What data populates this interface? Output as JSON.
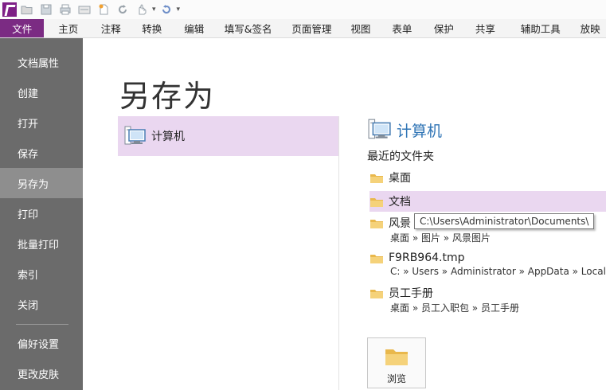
{
  "qat": {
    "icons": [
      "open-folder-icon",
      "save-icon",
      "print-icon",
      "scan-icon",
      "new-document-icon",
      "redo-icon",
      "hand-tool-icon",
      "undo-icon"
    ],
    "dropdown_glyph": "▾"
  },
  "tabs": [
    "文件",
    "主页",
    "注释",
    "转换",
    "编辑",
    "填写&签名",
    "页面管理",
    "视图",
    "表单",
    "保护",
    "共享",
    "辅助工具",
    "放映"
  ],
  "nav": {
    "items": [
      "文档属性",
      "创建",
      "打开",
      "保存",
      "另存为",
      "打印",
      "批量打印",
      "索引",
      "关闭",
      "偏好设置",
      "更改皮肤"
    ],
    "active": "另存为"
  },
  "main": {
    "title": "另存为",
    "place": "计算机",
    "right_title": "计算机",
    "recent_label": "最近的文件夹",
    "folders": [
      {
        "name": "桌面",
        "path": ""
      },
      {
        "name": "文档",
        "path": ""
      },
      {
        "name": "风景",
        "path": "桌面 » 图片 » 风景图片"
      },
      {
        "name": "F9RB964.tmp",
        "path": "C: » Users » Administrator » AppData » Local » T"
      },
      {
        "name": "员工手册",
        "path": "桌面 » 员工入职包 » 员工手册"
      }
    ],
    "tooltip": "C:\\Users\\Administrator\\Documents\\",
    "browse_label": "浏览"
  },
  "colors": {
    "accent_purple": "#7b2b83",
    "highlight": "#ead7f0",
    "nav_bg": "#6b6b6b",
    "nav_active": "#8e8e8e",
    "link_blue": "#2f74b5",
    "folder_yellow": "#f0c060"
  }
}
